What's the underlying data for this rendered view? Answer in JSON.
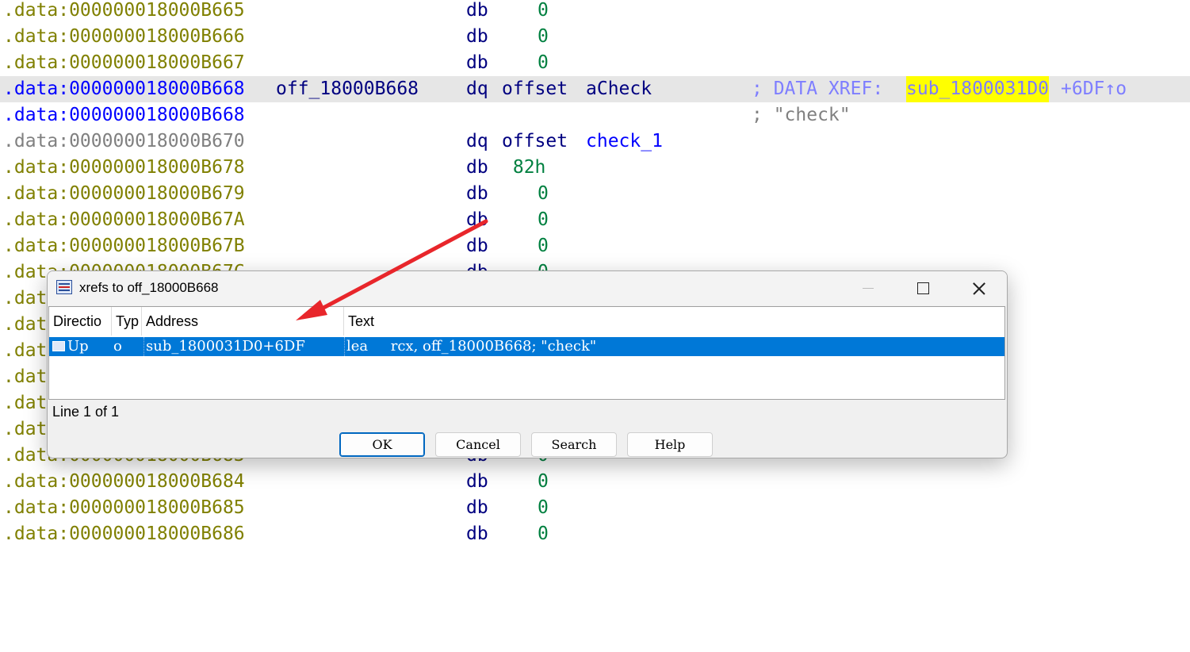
{
  "listing": [
    {
      "addr": ".data:000000018000B665",
      "label": "",
      "mnemonic": "db",
      "operand": "0",
      "operand_kind": "num",
      "comment": ""
    },
    {
      "addr": ".data:000000018000B666",
      "label": "",
      "mnemonic": "db",
      "operand": "0",
      "operand_kind": "num",
      "comment": ""
    },
    {
      "addr": ".data:000000018000B667",
      "label": "",
      "mnemonic": "db",
      "operand": "0",
      "operand_kind": "num",
      "comment": ""
    },
    {
      "addr": ".data:000000018000B668",
      "label": "off_18000B668",
      "mnemonic": "dq",
      "operand_kw": "offset",
      "operand_name": "aCheck",
      "comment_prefix": "; DATA XREF: ",
      "comment_ref": "sub_1800031D0",
      "comment_suffix": "+6DF↑o"
    },
    {
      "addr": ".data:000000018000B668",
      "label": "",
      "mnemonic": "",
      "operand": "",
      "comment_string": "; \"check\""
    },
    {
      "addr": ".data:000000018000B670",
      "label": "",
      "mnemonic": "dq",
      "operand_kw": "offset",
      "operand_name": "check_1",
      "comment": ""
    },
    {
      "addr": ".data:000000018000B678",
      "label": "",
      "mnemonic": "db",
      "operand": " 82h",
      "operand_kind": "num",
      "comment": ""
    },
    {
      "addr": ".data:000000018000B679",
      "label": "",
      "mnemonic": "db",
      "operand": "0",
      "operand_kind": "num",
      "comment": ""
    },
    {
      "addr": ".data:000000018000B67A",
      "label": "",
      "mnemonic": "db",
      "operand": "0",
      "operand_kind": "num",
      "comment": ""
    },
    {
      "addr": ".data:000000018000B67B",
      "label": "",
      "mnemonic": "db",
      "operand": "0",
      "operand_kind": "num",
      "comment": ""
    },
    {
      "addr": ".data:000000018000B67C",
      "label": "",
      "mnemonic": "db",
      "operand": "0",
      "operand_kind": "num",
      "comment": ""
    },
    {
      "addr": ".dat",
      "label": "",
      "mnemonic": "",
      "operand": "",
      "comment": ""
    },
    {
      "addr": ".dat",
      "label": "",
      "mnemonic": "",
      "operand": "",
      "comment": ""
    },
    {
      "addr": ".dat",
      "label": "",
      "mnemonic": "",
      "operand": "",
      "comment": ""
    },
    {
      "addr": ".dat",
      "label": "",
      "mnemonic": "",
      "operand": "",
      "comment": ""
    },
    {
      "addr": ".dat",
      "label": "",
      "mnemonic": "",
      "operand": "",
      "comment": ""
    },
    {
      "addr": ".dat",
      "label": "",
      "mnemonic": "",
      "operand": "",
      "comment": ""
    },
    {
      "addr": ".data:000000018000B683",
      "label": "",
      "mnemonic": "db",
      "operand": "0",
      "operand_kind": "num",
      "comment": ""
    },
    {
      "addr": ".data:000000018000B684",
      "label": "",
      "mnemonic": "db",
      "operand": "0",
      "operand_kind": "num",
      "comment": ""
    },
    {
      "addr": ".data:000000018000B685",
      "label": "",
      "mnemonic": "db",
      "operand": "0",
      "operand_kind": "num",
      "comment": ""
    },
    {
      "addr": ".data:000000018000B686",
      "label": "",
      "mnemonic": "db",
      "operand": "0",
      "operand_kind": "num",
      "comment": ""
    }
  ],
  "dialog": {
    "title": "xrefs to off_18000B668",
    "columns": [
      "Directio",
      "Typ",
      "Address",
      "Text"
    ],
    "rows": [
      {
        "direction": "Up",
        "type": "o",
        "address": "sub_1800031D0+6DF",
        "text": "lea     rcx, off_18000B668; \"check\""
      }
    ],
    "status": "Line 1 of 1",
    "buttons": {
      "ok": "OK",
      "cancel": "Cancel",
      "search": "Search",
      "help": "Help"
    }
  },
  "colors": {
    "address_data": "#808000",
    "address_current": "#0000ff",
    "comment": "#7e7eff",
    "highlight": "#ffff00",
    "selection": "#0078d7",
    "arrow": "#e8262b"
  },
  "icons": [
    "xrefs-window-icon",
    "minimize-icon",
    "maximize-icon",
    "close-icon",
    "row-xref-icon"
  ]
}
